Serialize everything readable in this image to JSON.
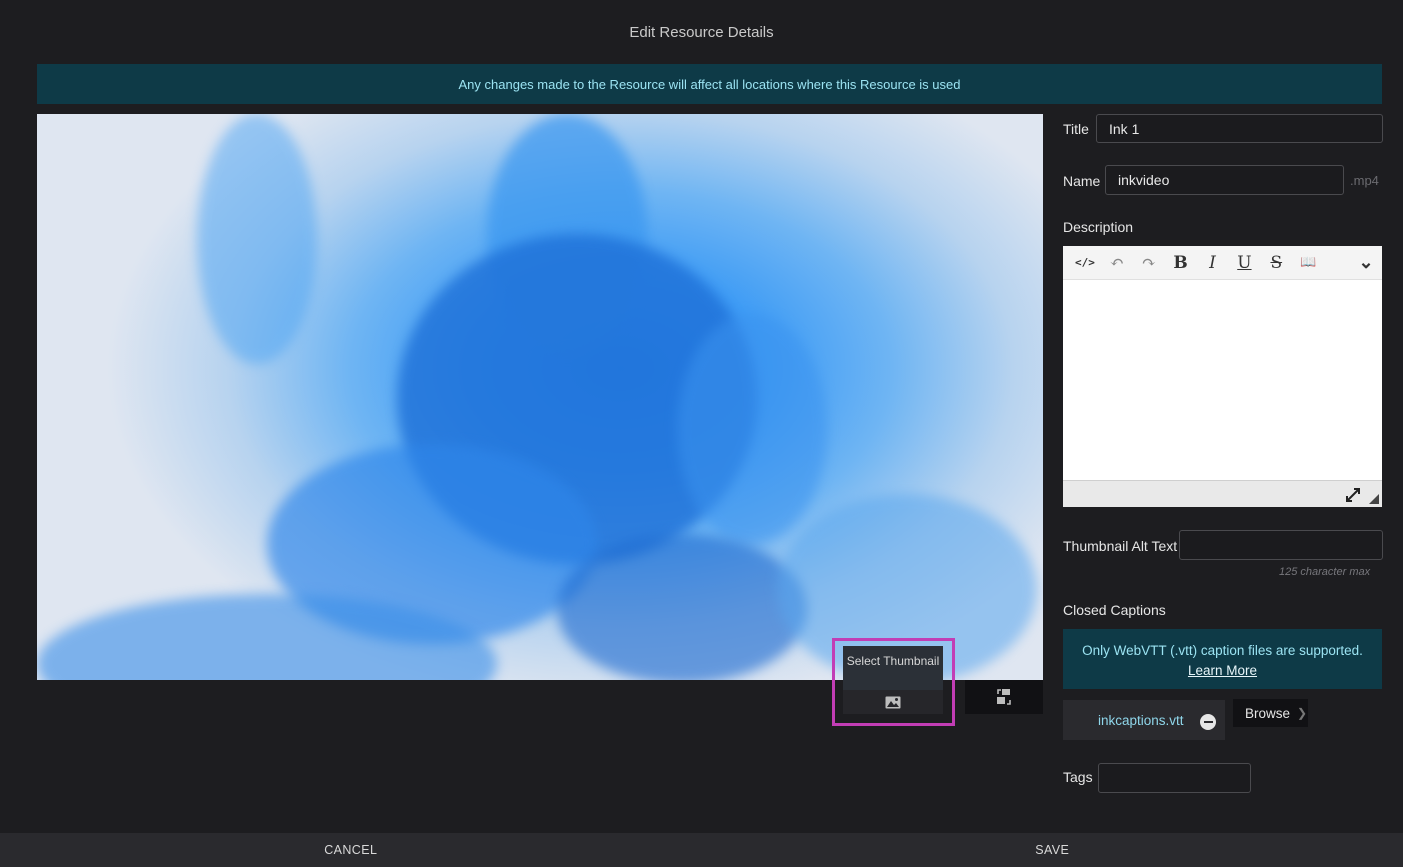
{
  "modal": {
    "title": "Edit Resource Details"
  },
  "notice": {
    "text": "Any changes made to the Resource will affect all locations where this Resource is used"
  },
  "video": {
    "thumbnail_tooltip": "Select Thumbnail",
    "thumbnail_icon": "image-icon",
    "extra_icon": "thumbnail-swap-icon"
  },
  "form": {
    "title_label": "Title",
    "title_value": "Ink 1",
    "name_label": "Name",
    "name_value": "inkvideo",
    "name_suffix": ".mp4",
    "description_label": "Description",
    "alt_label": "Thumbnail Alt Text",
    "alt_value": "",
    "alt_hint": "125 character max",
    "cc_label": "Closed Captions",
    "cc_notice": "Only WebVTT (.vtt) caption files are supported.",
    "cc_learn_more": "Learn More",
    "cc_file": "inkcaptions.vtt",
    "browse_label": "Browse",
    "tags_label": "Tags",
    "tags_value": ""
  },
  "editor_toolbar": [
    {
      "name": "source-code-icon",
      "glyph": "</>"
    },
    {
      "name": "undo-icon",
      "glyph": "↶"
    },
    {
      "name": "redo-icon",
      "glyph": "↷"
    },
    {
      "name": "bold-icon",
      "glyph": "B"
    },
    {
      "name": "italic-icon",
      "glyph": "I"
    },
    {
      "name": "underline-icon",
      "glyph": "U"
    },
    {
      "name": "strikethrough-icon",
      "glyph": "S"
    },
    {
      "name": "book-icon",
      "glyph": "📖"
    },
    {
      "name": "chevron-down-icon",
      "glyph": "⌄"
    }
  ],
  "footer": {
    "cancel": "CANCEL",
    "save": "SAVE"
  }
}
